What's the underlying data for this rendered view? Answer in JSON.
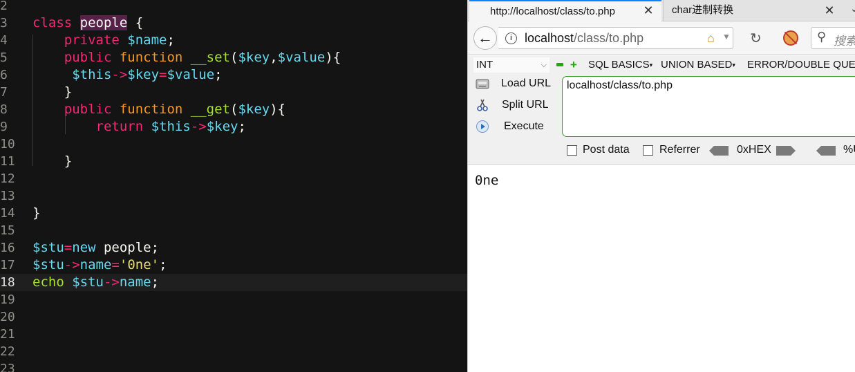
{
  "editor": {
    "lines": [
      {
        "num": "2",
        "tokens": []
      },
      {
        "num": "3",
        "tokens": [
          {
            "t": "class ",
            "c": "t-pink"
          },
          {
            "t": "people",
            "c": "t-class-name"
          },
          {
            "t": " {",
            "c": "t-plain"
          }
        ]
      },
      {
        "num": "4",
        "tokens": [
          {
            "t": "    private ",
            "c": "t-pink"
          },
          {
            "t": "$name",
            "c": "t-cyan"
          },
          {
            "t": ";",
            "c": "t-plain"
          }
        ]
      },
      {
        "num": "5",
        "tokens": [
          {
            "t": "    public ",
            "c": "t-pink"
          },
          {
            "t": "function ",
            "c": "t-orange"
          },
          {
            "t": "__set",
            "c": "t-green"
          },
          {
            "t": "(",
            "c": "t-plain"
          },
          {
            "t": "$key",
            "c": "t-cyan"
          },
          {
            "t": ",",
            "c": "t-plain"
          },
          {
            "t": "$value",
            "c": "t-cyan"
          },
          {
            "t": "){",
            "c": "t-plain"
          }
        ]
      },
      {
        "num": "6",
        "tokens": [
          {
            "t": "     $this",
            "c": "t-cyan"
          },
          {
            "t": "->",
            "c": "t-pink"
          },
          {
            "t": "$key",
            "c": "t-cyan"
          },
          {
            "t": "=",
            "c": "t-pink"
          },
          {
            "t": "$value",
            "c": "t-cyan"
          },
          {
            "t": ";",
            "c": "t-plain"
          }
        ]
      },
      {
        "num": "7",
        "tokens": [
          {
            "t": "    }",
            "c": "t-plain"
          }
        ]
      },
      {
        "num": "8",
        "tokens": [
          {
            "t": "    public ",
            "c": "t-pink"
          },
          {
            "t": "function ",
            "c": "t-orange"
          },
          {
            "t": "__get",
            "c": "t-green"
          },
          {
            "t": "(",
            "c": "t-plain"
          },
          {
            "t": "$key",
            "c": "t-cyan"
          },
          {
            "t": "){",
            "c": "t-plain"
          }
        ]
      },
      {
        "num": "9",
        "tokens": [
          {
            "t": "        return ",
            "c": "t-pink"
          },
          {
            "t": "$this",
            "c": "t-cyan"
          },
          {
            "t": "->",
            "c": "t-pink"
          },
          {
            "t": "$key",
            "c": "t-cyan"
          },
          {
            "t": ";",
            "c": "t-plain"
          }
        ]
      },
      {
        "num": "10",
        "tokens": []
      },
      {
        "num": "11",
        "tokens": [
          {
            "t": "    }",
            "c": "t-plain"
          }
        ]
      },
      {
        "num": "12",
        "tokens": []
      },
      {
        "num": "13",
        "tokens": []
      },
      {
        "num": "14",
        "tokens": [
          {
            "t": "}",
            "c": "t-plain"
          }
        ]
      },
      {
        "num": "15",
        "tokens": []
      },
      {
        "num": "16",
        "tokens": [
          {
            "t": "$stu",
            "c": "t-cyan"
          },
          {
            "t": "=",
            "c": "t-pink"
          },
          {
            "t": "new ",
            "c": "t-cyan"
          },
          {
            "t": "people;",
            "c": "t-plain"
          }
        ]
      },
      {
        "num": "17",
        "tokens": [
          {
            "t": "$stu",
            "c": "t-cyan"
          },
          {
            "t": "->",
            "c": "t-pink"
          },
          {
            "t": "name",
            "c": "t-cyan"
          },
          {
            "t": "=",
            "c": "t-pink"
          },
          {
            "t": "'0ne'",
            "c": "t-yellow"
          },
          {
            "t": ";",
            "c": "t-plain"
          }
        ]
      },
      {
        "num": "18",
        "tokens": [
          {
            "t": "echo ",
            "c": "t-green"
          },
          {
            "t": "$stu",
            "c": "t-cyan"
          },
          {
            "t": "->",
            "c": "t-pink"
          },
          {
            "t": "name",
            "c": "t-cyan"
          },
          {
            "t": ";",
            "c": "t-plain"
          }
        ],
        "current": true
      },
      {
        "num": "19",
        "tokens": []
      },
      {
        "num": "20",
        "tokens": []
      },
      {
        "num": "21",
        "tokens": []
      },
      {
        "num": "22",
        "tokens": []
      },
      {
        "num": "23",
        "tokens": []
      }
    ]
  },
  "browser": {
    "tabs": [
      {
        "label": "http://localhost/class/to.php",
        "active": true
      },
      {
        "label": "char进制转换",
        "active": false
      }
    ],
    "url_host": "localhost",
    "url_path": "/class/to.php",
    "search_placeholder": "搜索",
    "hackbar": {
      "select_value": "INT",
      "menus": [
        "SQL BASICS",
        "UNION BASED",
        "ERROR/DOUBLE QUERY"
      ],
      "load_url": "Load URL",
      "split_url": "Split URL",
      "execute": "Execute",
      "url_value": "localhost/class/to.php",
      "post_data": "Post data",
      "referrer": "Referrer",
      "hex": "0xHEX",
      "percent": "%URL"
    },
    "output": "0ne"
  },
  "colors": {
    "editor_bg": "#141414",
    "keyword": "#f92672",
    "function": "#fd971f",
    "variable": "#66d9ef",
    "method": "#a6e22e",
    "string": "#e6db74",
    "hackbar_green": "#22a80c"
  }
}
